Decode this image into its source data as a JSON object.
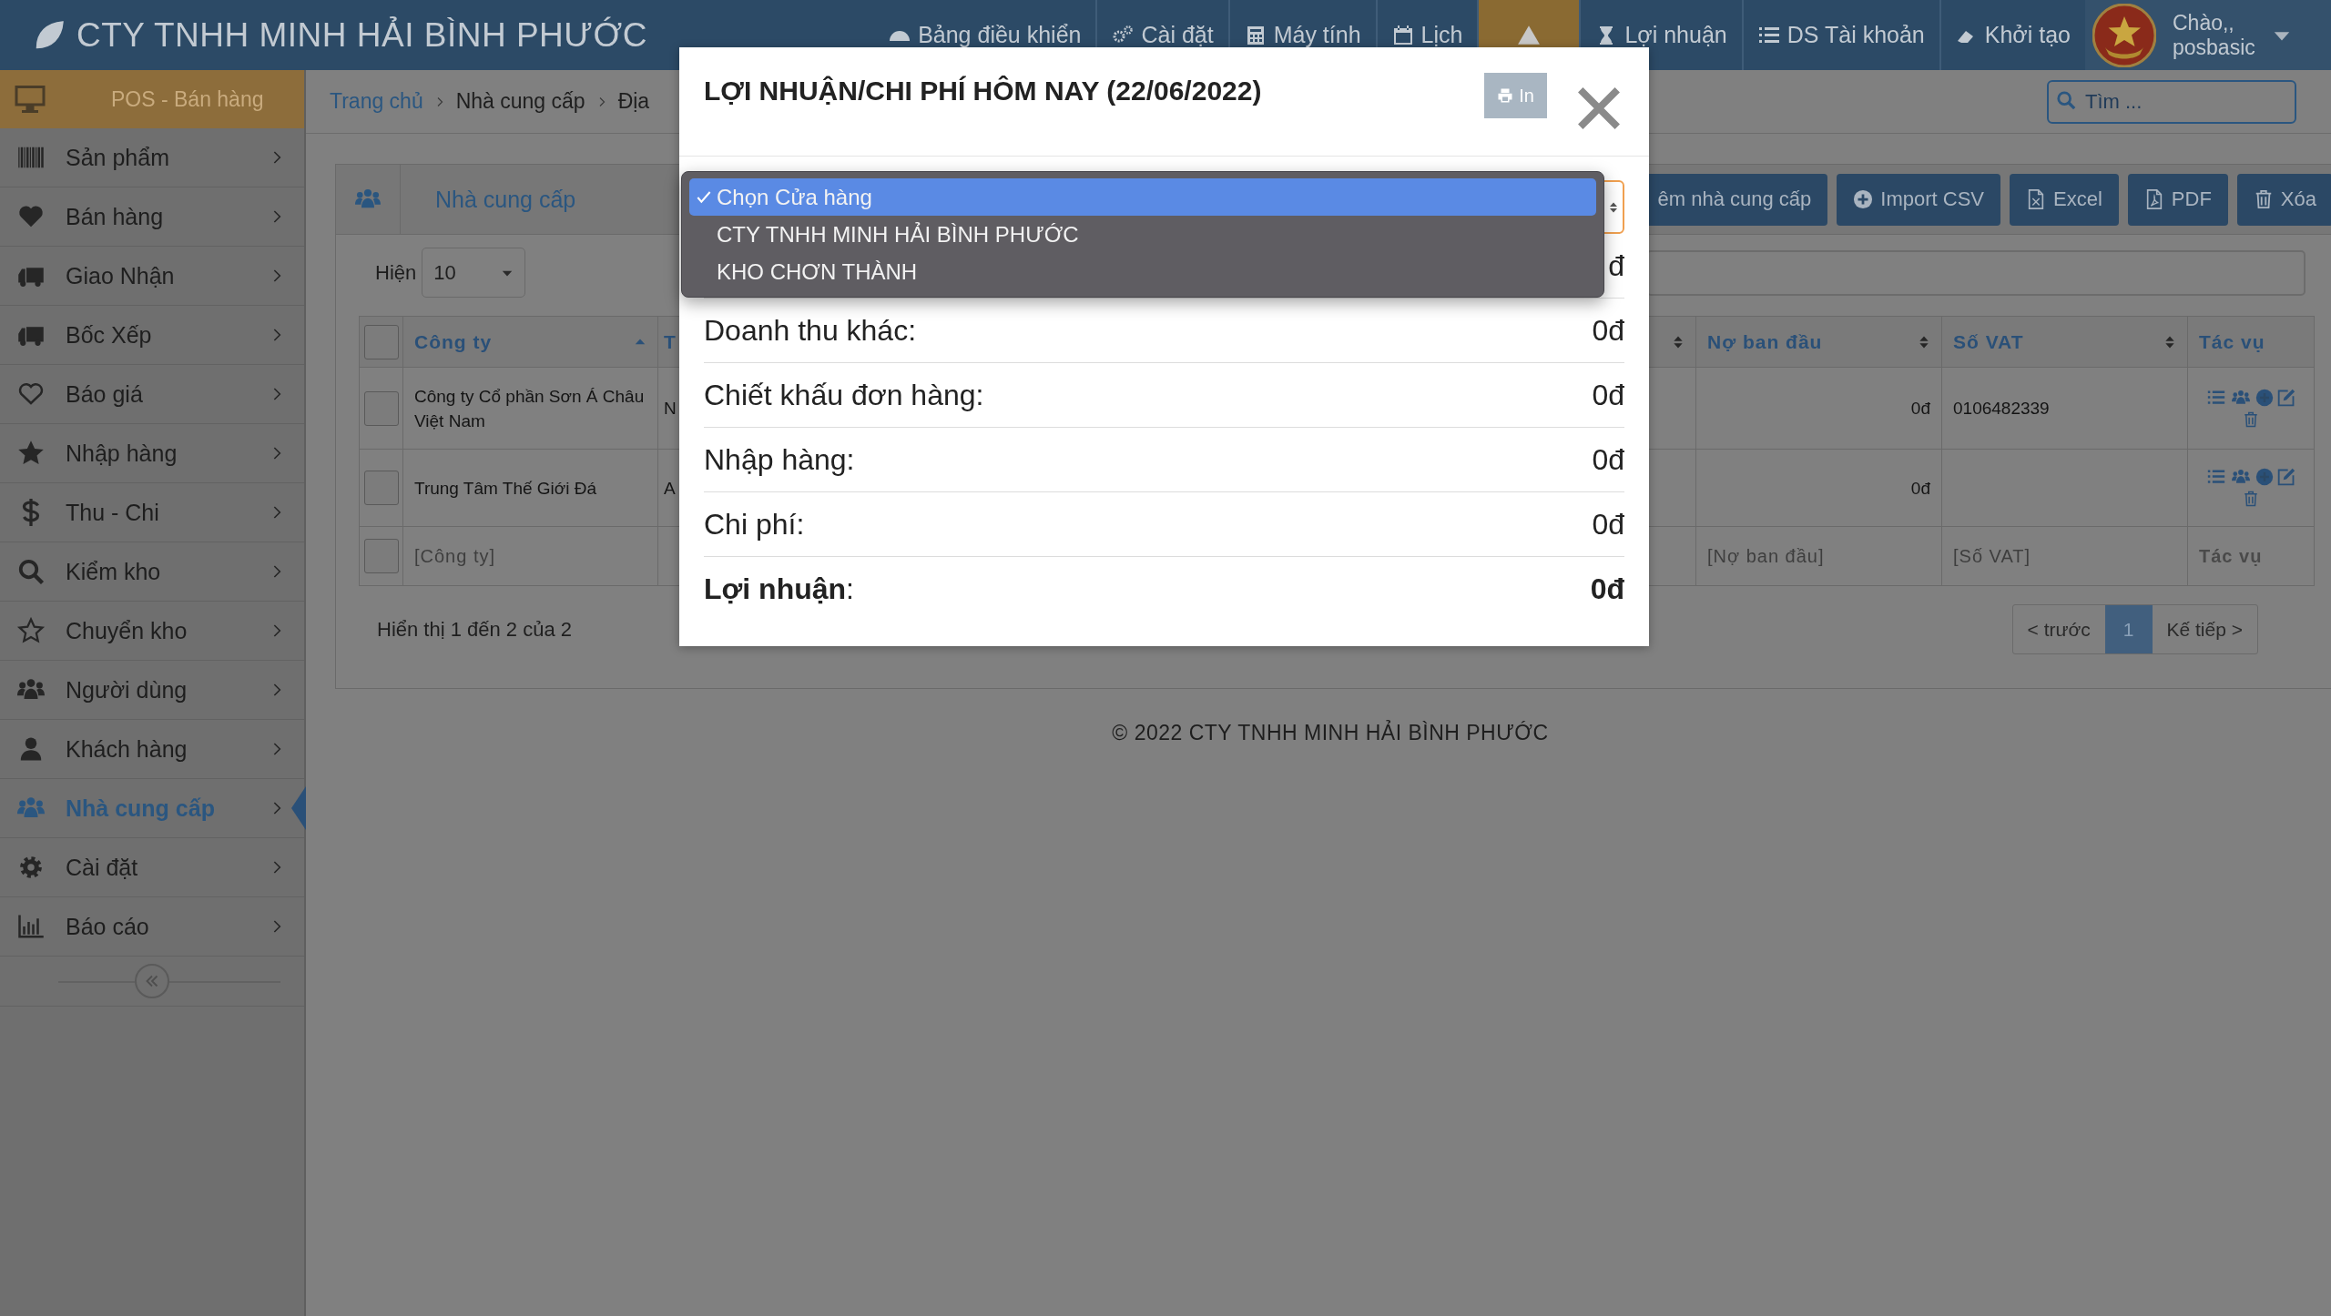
{
  "header": {
    "brand": "CTY TNHH MINH HẢI BÌNH PHƯỚC",
    "nav": [
      {
        "kind": "dashboard",
        "label": "Bảng điều khiển"
      },
      {
        "kind": "settings",
        "label": "Cài đặt"
      },
      {
        "kind": "calculator",
        "label": "Máy tính"
      },
      {
        "kind": "calendar",
        "label": "Lịch"
      },
      {
        "kind": "alert"
      },
      {
        "kind": "profit",
        "label": "Lợi nhuận"
      },
      {
        "kind": "accounts",
        "label": "DS Tài khoản"
      },
      {
        "kind": "reset",
        "label": "Khởi tạo"
      }
    ],
    "user": {
      "greeting": "Chào,,",
      "name": "posbasic"
    }
  },
  "sidebar": {
    "pos": "POS - Bán hàng",
    "items": [
      {
        "label": "Sản phẩm",
        "selected": false
      },
      {
        "label": "Bán hàng",
        "selected": false
      },
      {
        "label": "Giao Nhận",
        "selected": false
      },
      {
        "label": "Bốc Xếp",
        "selected": false
      },
      {
        "label": "Báo giá",
        "selected": false
      },
      {
        "label": "Nhập hàng",
        "selected": false
      },
      {
        "label": "Thu - Chi",
        "selected": false
      },
      {
        "label": "Kiểm kho",
        "selected": false
      },
      {
        "label": "Chuyển kho",
        "selected": false
      },
      {
        "label": "Người dùng",
        "selected": false
      },
      {
        "label": "Khách hàng",
        "selected": false
      },
      {
        "label": "Nhà cung cấp",
        "selected": true
      },
      {
        "label": "Cài đặt",
        "selected": false
      },
      {
        "label": "Báo cáo",
        "selected": false
      }
    ]
  },
  "breadcrumb": [
    "Trang chủ",
    "Nhà cung cấp",
    "Địa"
  ],
  "search": {
    "placeholder": "Tìm ..."
  },
  "panel": {
    "title": "Nhà cung cấp",
    "buttons": [
      {
        "kind": "add",
        "label": "êm nhà cung cấp"
      },
      {
        "kind": "import",
        "label": "Import CSV"
      },
      {
        "kind": "excel",
        "label": "Excel"
      },
      {
        "kind": "pdf",
        "label": "PDF"
      },
      {
        "kind": "delete",
        "label": "Xóa"
      }
    ]
  },
  "page_size": {
    "label": "Hiện",
    "value": "10"
  },
  "table": {
    "select_all_checked": false,
    "columns": [
      {
        "label": "Công ty",
        "kind": "sorted"
      },
      {
        "label": "T",
        "kind": "plain"
      },
      {
        "kind": "sortable"
      },
      {
        "label": "Nợ ban đầu",
        "kind": "sortable"
      },
      {
        "label": "Số VAT",
        "kind": "sortable"
      },
      {
        "label": "Tác vụ",
        "kind": "plain"
      }
    ],
    "rows": [
      {
        "checked": false,
        "company": "Công ty Cổ phần Sơn Á Châu Việt Nam",
        "column_3": "N",
        "debt": "0đ",
        "vat": "0106482339"
      },
      {
        "checked": false,
        "company": "Trung Tâm Thế Giới Đá",
        "column_3": "A",
        "debt": "0đ"
      }
    ],
    "filters": {
      "checked": false,
      "company": "[Công ty]",
      "debt": "[Nợ ban đầu]",
      "vat": "[Số VAT]",
      "actions": "Tác vụ"
    }
  },
  "summary": "Hiển thị 1 đến 2 của 2",
  "pagination": {
    "prev": "< trước",
    "pages": [
      {
        "label": "1",
        "selected": true
      }
    ],
    "next": "Kế tiếp >"
  },
  "footer": "© 2022 CTY TNHH MINH HẢI BÌNH PHƯỚC",
  "modal": {
    "title": "LỢI NHUẬN/CHI PHÍ HÔM NAY (22/06/2022)",
    "print": "In",
    "store_select": {
      "expanded": true,
      "options": [
        {
          "label": "Chọn Cửa hàng",
          "selected": true
        },
        {
          "label": "CTY TNHH MINH HẢI BÌNH PHƯỚC",
          "selected": false
        },
        {
          "label": "KHO CHƠN THÀNH",
          "selected": false
        }
      ]
    },
    "rows": [
      {
        "value": "đ"
      },
      {
        "label": "Doanh thu khác:",
        "value": "0đ"
      },
      {
        "label": "Chiết khấu đơn hàng:",
        "value": "0đ"
      },
      {
        "label": "Nhập hàng:",
        "value": "0đ"
      },
      {
        "label": "Chi phí:",
        "value": "0đ"
      },
      {
        "label": "**Lợi nhuận**:",
        "value": "0đ",
        "kind": "total"
      }
    ]
  }
}
